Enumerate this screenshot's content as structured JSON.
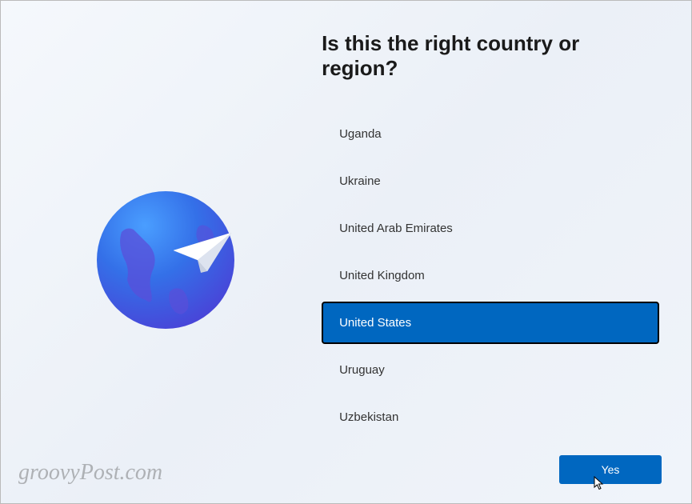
{
  "heading": "Is this the right country or region?",
  "countries": [
    {
      "name": "Uganda",
      "selected": false
    },
    {
      "name": "Ukraine",
      "selected": false
    },
    {
      "name": "United Arab Emirates",
      "selected": false
    },
    {
      "name": "United Kingdom",
      "selected": false
    },
    {
      "name": "United States",
      "selected": true
    },
    {
      "name": "Uruguay",
      "selected": false
    },
    {
      "name": "Uzbekistan",
      "selected": false
    }
  ],
  "confirm_button_label": "Yes",
  "watermark": "groovyPost.com",
  "icon_name": "globe-paper-plane-icon",
  "colors": {
    "accent": "#0067c0",
    "selected_border": "#000000"
  }
}
